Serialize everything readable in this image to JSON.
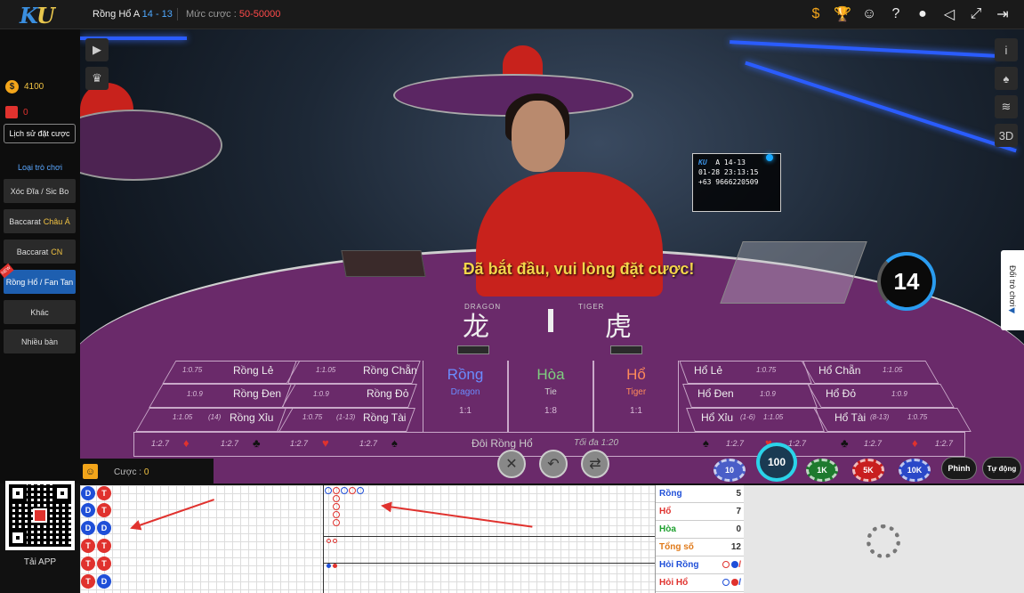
{
  "topbar": {
    "logo_k": "K",
    "logo_u": "U",
    "table_name": "Rồng Hổ A",
    "table_sub": "14 - 13",
    "bet_label": "Mức cược :",
    "bet_range": "50-50000",
    "icons": [
      "coin-icon",
      "trophy-icon",
      "user-add-icon",
      "help-icon",
      "support-24-icon",
      "sound-icon",
      "fullscreen-icon",
      "exit-icon"
    ]
  },
  "sidebar": {
    "balance": "4100",
    "gift_count": "0",
    "history_button": "Lịch sử đặt cược",
    "game_type_heading": "Loại trò chơi",
    "items": [
      {
        "label": "Xóc Đĩa / Sic Bo",
        "highlight": ""
      },
      {
        "label": "Baccarat",
        "highlight": "Châu Á"
      },
      {
        "label": "Baccarat",
        "highlight": "CN"
      },
      {
        "label": "Rồng Hổ / Fan Tan",
        "highlight": ""
      },
      {
        "label": "Khác",
        "highlight": ""
      },
      {
        "label": "Nhiều bàn",
        "highlight": ""
      }
    ]
  },
  "video": {
    "info_card": {
      "brand": "KU",
      "table": "A 14-13",
      "datetime": "01-28  23:13:15",
      "phone": "+63 9666220509"
    },
    "message": "Đã bắt đầu, vui lòng đặt cược!",
    "countdown": "14",
    "dragon_label": "DRAGON",
    "tiger_label": "TIGER",
    "dragon_char": "龙",
    "tiger_char": "虎",
    "switch_tab": "Đổi trò chơi",
    "side_icons": [
      "info-icon",
      "spade-icon",
      "wifi-icon",
      "3d-icon"
    ],
    "side_3d": "3D"
  },
  "board": {
    "left": [
      {
        "name": "Rồng Lẻ",
        "odds": "1:0.75"
      },
      {
        "name": "Rồng Đen",
        "odds": "1:0.9"
      },
      {
        "name": "Rồng Xỉu",
        "odds": "1:1.05",
        "extra": "(14)"
      }
    ],
    "left2": [
      {
        "name": "Rồng Chẵn",
        "odds": "1:1.05"
      },
      {
        "name": "Rồng Đỏ",
        "odds": "1:0.9"
      },
      {
        "name": "Rồng Tài",
        "odds": "1:0.75",
        "extra": "(1-13)"
      }
    ],
    "main": [
      {
        "title": "Rồng",
        "sub": "Dragon",
        "odds": "1:1",
        "color": "#6a8cff"
      },
      {
        "title": "Hòa",
        "sub": "Tie",
        "odds": "1:8",
        "color": "#7fd07f"
      },
      {
        "title": "Hổ",
        "sub": "Tiger",
        "odds": "1:1",
        "color": "#ff8a5a"
      }
    ],
    "right": [
      {
        "name": "Hổ Lẻ",
        "odds": "1:0.75"
      },
      {
        "name": "Hổ Đen",
        "odds": "1:0.9"
      },
      {
        "name": "Hổ Xỉu",
        "odds": "1:1.05",
        "extra": "(1-6)"
      }
    ],
    "right2": [
      {
        "name": "Hổ Chẵn",
        "odds": "1:1.05"
      },
      {
        "name": "Hổ Đỏ",
        "odds": "1:0.9"
      },
      {
        "name": "Hổ Tài",
        "odds": "1:0.75",
        "extra": "(8-13)"
      }
    ],
    "pair_odds": "1:2.7",
    "pair_center": "Đôi Rồng Hổ",
    "pair_max": "Tối đa 1:20"
  },
  "betbar": {
    "label": "Cược :",
    "value": "0"
  },
  "controls": [
    "cancel-icon",
    "undo-icon",
    "repeat-icon"
  ],
  "chips": [
    {
      "label": "10",
      "color": "#4a5ec8"
    },
    {
      "label": "100",
      "color": "#1a3a52"
    },
    {
      "label": "1K",
      "color": "#1e7a2e"
    },
    {
      "label": "5K",
      "color": "#c81e1e"
    },
    {
      "label": "10K",
      "color": "#2a48c8"
    },
    {
      "label": "Phỉnh",
      "color": "#1a1a1a"
    },
    {
      "label": "Tự động",
      "color": "#1a1a1a"
    }
  ],
  "qr": {
    "label": "Tải APP"
  },
  "bead_road": [
    [
      "D",
      "T"
    ],
    [
      "D",
      "T"
    ],
    [
      "D",
      "D"
    ],
    [
      "T",
      "T"
    ],
    [
      "T",
      "T"
    ],
    [
      "T",
      "D"
    ]
  ],
  "stats": [
    {
      "name": "Rồng",
      "value": "5",
      "cls": "blue"
    },
    {
      "name": "Hổ",
      "value": "7",
      "cls": "red"
    },
    {
      "name": "Hòa",
      "value": "0",
      "cls": "green"
    },
    {
      "name": "Tổng số",
      "value": "12",
      "cls": "orange"
    },
    {
      "name": "Hỏi Rồng",
      "value": "",
      "cls": "blue"
    },
    {
      "name": "Hỏi Hổ",
      "value": "",
      "cls": "red"
    }
  ]
}
